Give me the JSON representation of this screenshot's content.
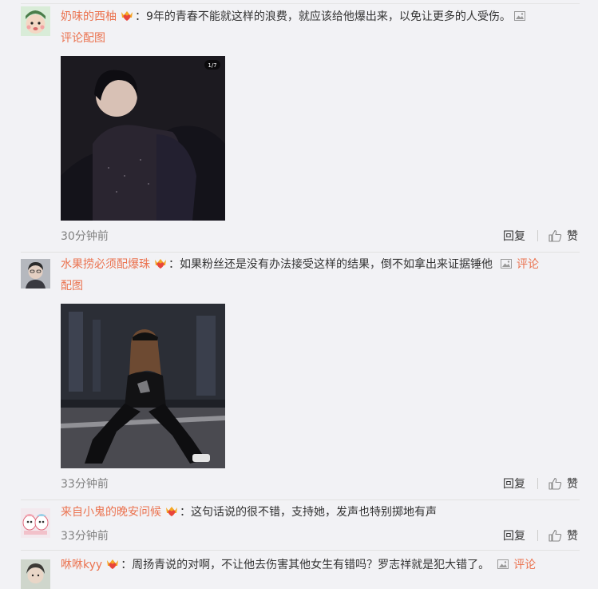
{
  "comments": [
    {
      "username": "奶味的西柚",
      "text": "：9年的青春不能就这样的浪费，就应该给他爆出来，以免让更多的人受伤。",
      "image_link": "评论配图",
      "time": "30分钟前",
      "reply": "回复",
      "like": "赞",
      "photo_counter": "1/7"
    },
    {
      "username": "水果捞必须配爆珠",
      "text": "：如果粉丝还是没有办法接受这样的结果，倒不如拿出来证据锤他",
      "image_link_a": "评论",
      "image_link_b": "配图",
      "time": "33分钟前",
      "reply": "回复",
      "like": "赞"
    },
    {
      "username": "来自小鬼的晚安问候",
      "text": "：这句话说的很不错，支持她，发声也特别掷地有声",
      "time": "33分钟前",
      "reply": "回复",
      "like": "赞"
    },
    {
      "username": "咻咻kyy",
      "text": "：周扬青说的对啊，不让他去伤害其他女生有错吗？罗志祥就是犯大错了。",
      "image_link": "评论"
    }
  ],
  "icons": {
    "badge": "vip-heart-badge-icon",
    "image": "image-icon",
    "like": "thumbs-up-icon"
  },
  "colors": {
    "username": "#eb7350",
    "text": "#333333",
    "time": "#808080",
    "background": "#f2f2f5"
  }
}
